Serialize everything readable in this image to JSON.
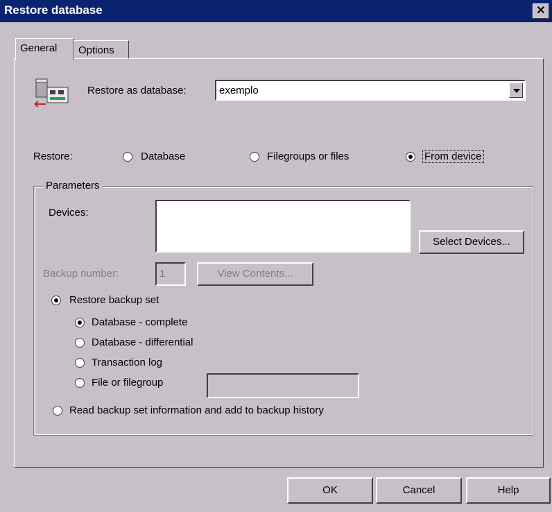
{
  "window": {
    "title": "Restore database",
    "close_glyph": "✕"
  },
  "tabs": [
    {
      "label": "General",
      "active": true
    },
    {
      "label": "Options",
      "active": false
    }
  ],
  "general": {
    "db_icon": "database-restore-icon",
    "restore_as_label": "Restore as database:",
    "restore_as_value": "exemplo",
    "restore_label": "Restore:",
    "restore_options": [
      {
        "label": "Database",
        "selected": false
      },
      {
        "label": "Filegroups or files",
        "selected": false
      },
      {
        "label": "From device",
        "selected": true
      }
    ],
    "parameters": {
      "legend": "Parameters",
      "devices_label": "Devices:",
      "devices_value": "",
      "select_devices_button": "Select Devices...",
      "backup_number_label": "Backup number:",
      "backup_number_value": "1",
      "view_contents_button": "View Contents...",
      "restore_backup_set_label": "Restore backup set",
      "restore_backup_set_selected": true,
      "backup_set_options": [
        {
          "label": "Database - complete",
          "selected": true
        },
        {
          "label": "Database - differential",
          "selected": false
        },
        {
          "label": "Transaction log",
          "selected": false
        },
        {
          "label": "File or filegroup",
          "selected": false
        }
      ],
      "file_or_filegroup_value": "",
      "read_backup_info_label": "Read backup set information and add to backup history",
      "read_backup_info_selected": false
    }
  },
  "buttons": {
    "ok": "OK",
    "cancel": "Cancel",
    "help": "Help"
  }
}
